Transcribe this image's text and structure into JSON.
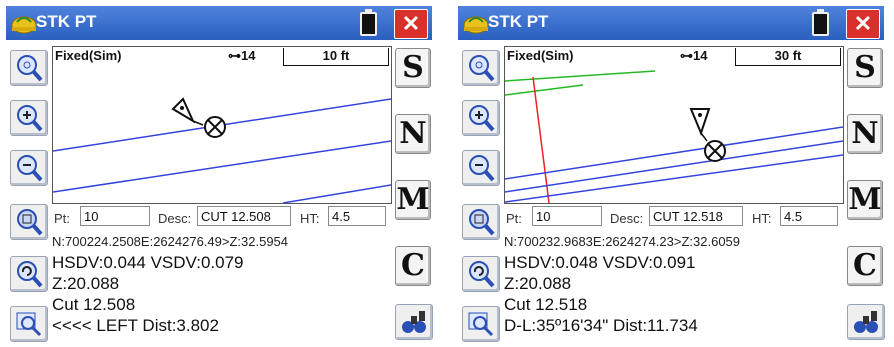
{
  "screens": [
    {
      "title": "STK PT",
      "fix_status": "Fixed(Sim)",
      "satellites": "14",
      "scale": "10 ft",
      "point_label": "Pt:",
      "point_value": "10",
      "desc_label": "Desc:",
      "desc_value": "CUT 12.508",
      "ht_label": "HT:",
      "ht_value": "4.5",
      "coords": "N:700224.2508E:2624276.49>Z:32.5954",
      "sdv": "HSDV:0.044 VSDV:0.079",
      "z": "Z:20.088",
      "cut": "Cut 12.508",
      "nav": "<<<< LEFT Dist:3.802"
    },
    {
      "title": "STK PT",
      "fix_status": "Fixed(Sim)",
      "satellites": "14",
      "scale": "30 ft",
      "point_label": "Pt:",
      "point_value": "10",
      "desc_label": "Desc:",
      "desc_value": "CUT 12.518",
      "ht_label": "HT:",
      "ht_value": "4.5",
      "coords": "N:700232.9683E:2624274.23>Z:32.6059",
      "sdv": "HSDV:0.048 VSDV:0.091",
      "z": "Z:20.088",
      "cut": "Cut 12.518",
      "nav": "D-L:35º16'34\" Dist:11.734"
    }
  ],
  "side_buttons": [
    "S",
    "N",
    "M",
    "C"
  ],
  "close_label": "✕",
  "colors": {
    "titlebar": "#2b5fc0",
    "close": "#d9302c",
    "alignment_lines": "#3344dd",
    "green_line": "#22bb22",
    "red_line": "#ee2222"
  }
}
